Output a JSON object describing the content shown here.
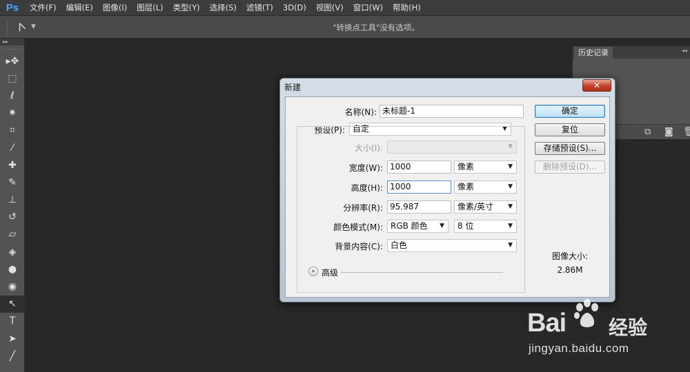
{
  "app": {
    "logo": "Ps",
    "menu": [
      "文件(F)",
      "编辑(E)",
      "图像(I)",
      "图层(L)",
      "类型(Y)",
      "选择(S)",
      "滤镜(T)",
      "3D(D)",
      "视图(V)",
      "窗口(W)",
      "帮助(H)"
    ]
  },
  "options_bar": {
    "tool_icon": "convert-point-tool-icon",
    "hint": "\"转换点工具\"没有选项。"
  },
  "toolbar": {
    "tools": [
      {
        "name": "move-tool",
        "glyph": "▸✥"
      },
      {
        "name": "marquee-tool",
        "glyph": "⬚"
      },
      {
        "name": "lasso-tool",
        "glyph": "ℓ"
      },
      {
        "name": "magic-wand-tool",
        "glyph": "✷"
      },
      {
        "name": "crop-tool",
        "glyph": "⌗"
      },
      {
        "name": "eyedropper-tool",
        "glyph": "⁄"
      },
      {
        "name": "healing-brush-tool",
        "glyph": "✚"
      },
      {
        "name": "brush-tool",
        "glyph": "✎"
      },
      {
        "name": "clone-stamp-tool",
        "glyph": "⊥"
      },
      {
        "name": "history-brush-tool",
        "glyph": "↺"
      },
      {
        "name": "eraser-tool",
        "glyph": "▱"
      },
      {
        "name": "paint-bucket-tool",
        "glyph": "◈"
      },
      {
        "name": "blur-tool",
        "glyph": "●"
      },
      {
        "name": "sponge-tool",
        "glyph": "◉"
      },
      {
        "name": "convert-point-tool",
        "glyph": "↖",
        "active": true
      },
      {
        "name": "type-tool",
        "glyph": "T"
      },
      {
        "name": "path-selection-tool",
        "glyph": "➤"
      },
      {
        "name": "line-tool",
        "glyph": "╱"
      }
    ]
  },
  "history_panel": {
    "tab": "历史记录"
  },
  "dialog": {
    "title": "新建",
    "close_label": "✕",
    "name_label": "名称(N):",
    "name_value": "未标题-1",
    "preset_label": "预设(P):",
    "preset_value": "自定",
    "size_label": "大小(I):",
    "size_value": "",
    "width_label": "宽度(W):",
    "width_value": "1000",
    "width_unit": "像素",
    "height_label": "高度(H):",
    "height_value": "1000",
    "height_unit": "像素",
    "resolution_label": "分辨率(R):",
    "resolution_value": "95.987",
    "resolution_unit": "像素/英寸",
    "color_mode_label": "颜色模式(M):",
    "color_mode_value": "RGB 颜色",
    "bit_depth_value": "8 位",
    "background_label": "背景内容(C):",
    "background_value": "白色",
    "advanced_label": "高级",
    "buttons": {
      "ok": "确定",
      "reset": "复位",
      "save_preset": "存储预设(S)...",
      "delete_preset": "删除预设(D)..."
    },
    "image_size_label": "图像大小:",
    "image_size_value": "2.86M"
  },
  "watermark": {
    "brand": "Bai",
    "brand_du": "du",
    "product": "经验",
    "url": "jingyan.baidu.com"
  }
}
